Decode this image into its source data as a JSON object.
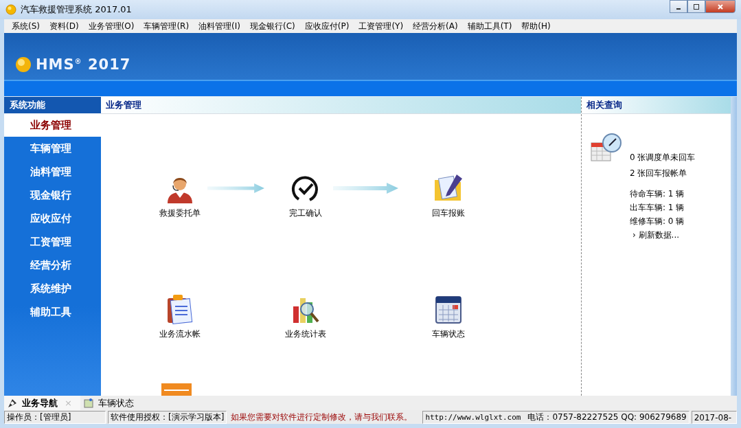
{
  "window": {
    "title": "汽车救援管理系统 2017.01"
  },
  "menu": [
    "系统(S)",
    "资料(D)",
    "业务管理(O)",
    "车辆管理(R)",
    "油料管理(I)",
    "现金银行(C)",
    "应收应付(P)",
    "工资管理(Y)",
    "经营分析(A)",
    "辅助工具(T)",
    "帮助(H)"
  ],
  "banner": {
    "logo": "HMS$^{®}$ 2017"
  },
  "sidebar": {
    "title": "系统功能",
    "items": [
      {
        "label": "业务管理",
        "selected": true
      },
      {
        "label": "车辆管理",
        "selected": false
      },
      {
        "label": "油料管理",
        "selected": false
      },
      {
        "label": "现金银行",
        "selected": false
      },
      {
        "label": "应收应付",
        "selected": false
      },
      {
        "label": "工资管理",
        "selected": false
      },
      {
        "label": "经营分析",
        "selected": false
      },
      {
        "label": "系统维护",
        "selected": false
      },
      {
        "label": "辅助工具",
        "selected": false
      }
    ]
  },
  "main": {
    "title": "业务管理",
    "tiles": [
      {
        "label": "救援委托单",
        "arrow_after": true
      },
      {
        "label": "完工确认",
        "arrow_after": true
      },
      {
        "label": "回车报账",
        "arrow_after": false
      },
      {
        "label": "业务流水帐",
        "arrow_after": false
      },
      {
        "label": "业务统计表",
        "arrow_after": false
      },
      {
        "label": "车辆状态",
        "arrow_after": false
      }
    ]
  },
  "related": {
    "title": "相关查询",
    "counts": [
      "0 张调度单未回车",
      "2 张回车报帐单"
    ],
    "vehicles": [
      "待命车辆: 1 辆",
      "出车车辆: 1 辆",
      "维修车辆: 0 辆"
    ],
    "refresh": "› 刷新数据..."
  },
  "bottom_tabs": [
    {
      "label": "业务导航",
      "selected": true,
      "close": "×"
    },
    {
      "label": "车辆状态",
      "selected": false
    }
  ],
  "status_bar": {
    "operator": "操作员：[管理员]",
    "license": "软件使用授权：[演示学习版本]",
    "message": "如果您需要对软件进行定制修改，请与我们联系。",
    "url": "http://www.wlglxt.com",
    "phone": "电话：0757-82227525 QQ: 906279689",
    "date": "2017-08-"
  }
}
